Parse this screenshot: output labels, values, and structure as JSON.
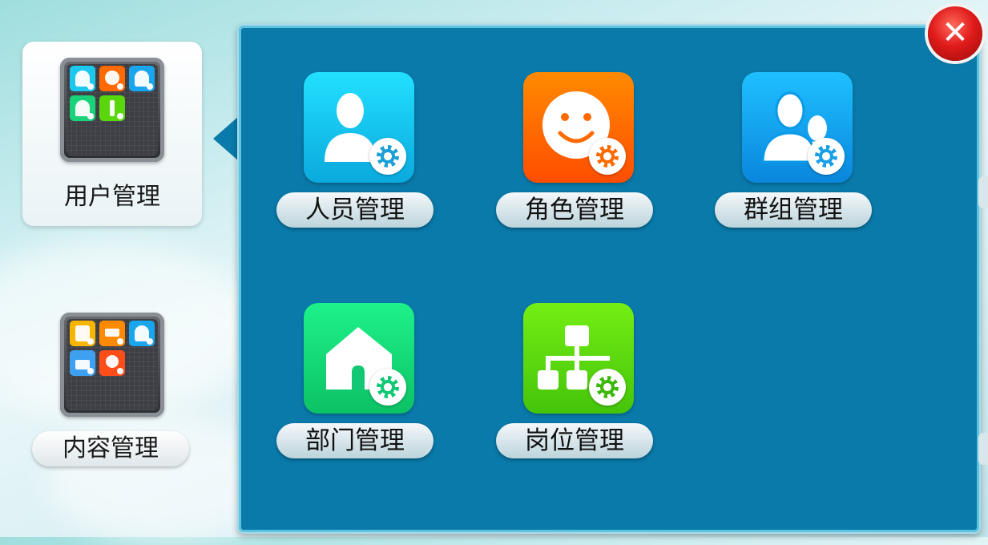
{
  "sidebar": {
    "categories": [
      {
        "label": "用户管理",
        "selected": true
      },
      {
        "label": "内容管理",
        "selected": false
      }
    ]
  },
  "panel": {
    "apps": [
      {
        "label": "人员管理",
        "icon": "person-settings-icon",
        "color": "#1cc8ee"
      },
      {
        "label": "角色管理",
        "icon": "smiley-settings-icon",
        "color": "#ff6a00"
      },
      {
        "label": "群组管理",
        "icon": "group-settings-icon",
        "color": "#1aa6ee"
      },
      {
        "label": "部门管理",
        "icon": "house-settings-icon",
        "color": "#19d27a"
      },
      {
        "label": "岗位管理",
        "icon": "org-chart-settings-icon",
        "color": "#5ad60d"
      }
    ]
  },
  "colors": {
    "panel_bg": "#0a7aaa",
    "close_button": "#e01b1b"
  }
}
